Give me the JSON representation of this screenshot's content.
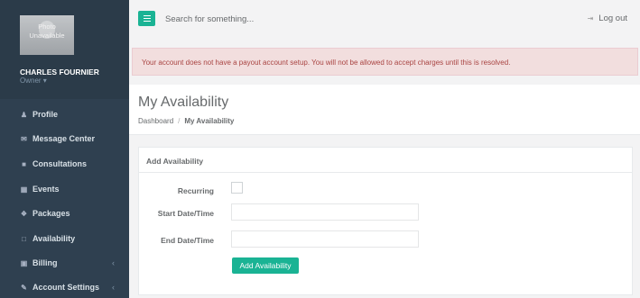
{
  "sidebar": {
    "profile": {
      "photo_text_1": "Photo",
      "photo_text_2": "Unavailable",
      "name": "CHARLES FOURNIER",
      "role": "Owner ▾"
    },
    "items": [
      {
        "label": "Profile",
        "icon": "user-icon",
        "glyph": "♟"
      },
      {
        "label": "Message Center",
        "icon": "envelope-icon",
        "glyph": "✉"
      },
      {
        "label": "Consultations",
        "icon": "book-icon",
        "glyph": "■"
      },
      {
        "label": "Events",
        "icon": "calendar-icon",
        "glyph": "▦"
      },
      {
        "label": "Packages",
        "icon": "cubes-icon",
        "glyph": "❖"
      },
      {
        "label": "Availability",
        "icon": "calendar-empty-icon",
        "glyph": "□"
      },
      {
        "label": "Billing",
        "icon": "money-icon",
        "glyph": "▣",
        "caret": "‹"
      },
      {
        "label": "Account Settings",
        "icon": "edit-icon",
        "glyph": "✎",
        "caret": "‹"
      }
    ]
  },
  "topbar": {
    "search_placeholder": "Search for something...",
    "logout_label": "Log out",
    "logout_glyph": "⇥"
  },
  "alert": {
    "text": "Your account does not have a payout account setup. You will not be allowed to accept charges until this is resolved."
  },
  "page": {
    "title": "My Availability",
    "breadcrumb": {
      "home": "Dashboard",
      "separator": "/",
      "current": "My Availability"
    }
  },
  "panel": {
    "title": "Add Availability",
    "recurring_label": "Recurring",
    "start_label": "Start Date/Time",
    "end_label": "End Date/Time",
    "start_value": "",
    "end_value": "",
    "button_label": "Add Availability"
  },
  "colors": {
    "sidebar": "#2f4050",
    "accent": "#1ab394",
    "alert_bg": "#f2dede",
    "alert_text": "#a94442"
  }
}
